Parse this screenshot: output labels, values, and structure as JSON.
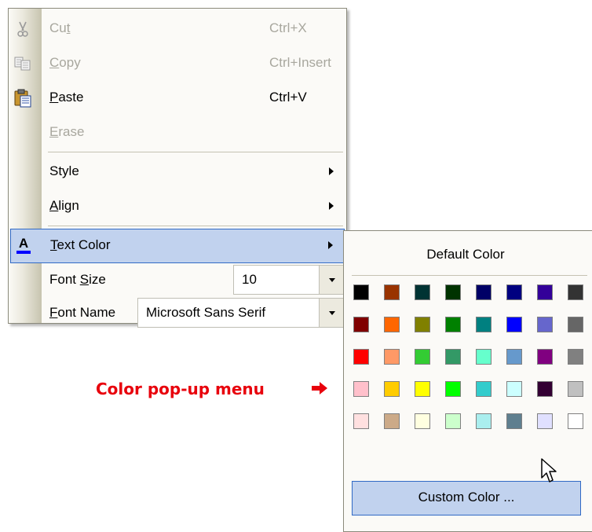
{
  "menu": {
    "items": [
      {
        "label_pre": "Cu",
        "label_acc": "t",
        "label_post": "",
        "shortcut": "Ctrl+X",
        "icon": "scissors-icon",
        "enabled": false
      },
      {
        "label_pre": "",
        "label_acc": "C",
        "label_post": "opy",
        "shortcut": "Ctrl+Insert",
        "icon": "copy-icon",
        "enabled": false
      },
      {
        "label_pre": "",
        "label_acc": "P",
        "label_post": "aste",
        "shortcut": "Ctrl+V",
        "icon": "paste-icon",
        "enabled": true
      },
      {
        "label_pre": "",
        "label_acc": "E",
        "label_post": "rase",
        "enabled": false
      },
      {
        "label": "Style",
        "submenu": true
      },
      {
        "label_pre": "",
        "label_acc": "A",
        "label_post": "lign",
        "submenu": true
      },
      {
        "label_pre": "",
        "label_acc": "T",
        "label_post": "ext Color",
        "submenu": true,
        "highlighted": true,
        "icon": "text-color-icon",
        "icon_text": "A"
      },
      {
        "label_pre": "Font ",
        "label_acc": "S",
        "label_post": "ize",
        "combo_value": "10"
      },
      {
        "label_pre": "",
        "label_acc": "F",
        "label_post": "ont Name",
        "combo_value": "Microsoft Sans Serif"
      }
    ]
  },
  "color_popup": {
    "default_label": "Default Color",
    "custom_label": "Custom Color ...",
    "swatches": [
      "#000000",
      "#993300",
      "#003333",
      "#003300",
      "#000066",
      "#000080",
      "#330099",
      "#333333",
      "#800000",
      "#FF6600",
      "#808000",
      "#008000",
      "#008080",
      "#0000FF",
      "#6666CC",
      "#666666",
      "#FF0000",
      "#FF9966",
      "#33CC33",
      "#339966",
      "#66FFCC",
      "#6699CC",
      "#800080",
      "#808080",
      "#FFC0CB",
      "#FFCC00",
      "#FFFF00",
      "#00FF00",
      "#33CCCC",
      "#CCFFFF",
      "#330033",
      "#C0C0C0",
      "#FFE0E0",
      "#CCAA88",
      "#FFFFE0",
      "#CCFFCC",
      "#AAEEEE",
      "#5F7F8F",
      "#E0E0FF",
      "#FFFFFF"
    ]
  },
  "annotation": {
    "text": "Color pop-up menu"
  },
  "colors": {
    "highlight_bg": "#C1D2EE",
    "highlight_border": "#316AC5",
    "annotation": "#E8000C",
    "text_color_underline": "#0000FF"
  }
}
